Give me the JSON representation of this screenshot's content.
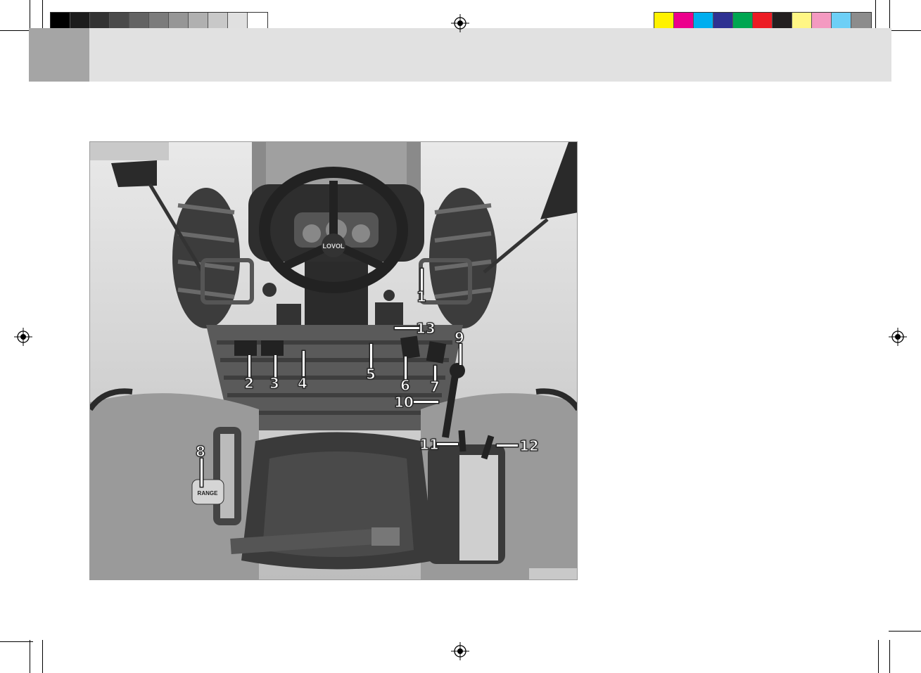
{
  "print_marks": {
    "grayscale_bar": [
      "#000000",
      "#1c1c1c",
      "#333333",
      "#4a4a4a",
      "#636363",
      "#7c7c7c",
      "#969696",
      "#b0b0b0",
      "#c8c8c8",
      "#e0e0e0",
      "#ffffff"
    ],
    "color_bar": [
      "#fff200",
      "#ec008c",
      "#00aeef",
      "#2e3192",
      "#00a651",
      "#ed1c24",
      "#231f20",
      "#fff685",
      "#f49ac1",
      "#6dcff6",
      "#8c8c8c"
    ]
  },
  "figure": {
    "steering_logo": "LOVOL",
    "range_label": "RANGE",
    "callouts": [
      "1",
      "2",
      "3",
      "4",
      "5",
      "6",
      "7",
      "8",
      "9",
      "10",
      "11",
      "12",
      "13"
    ]
  }
}
